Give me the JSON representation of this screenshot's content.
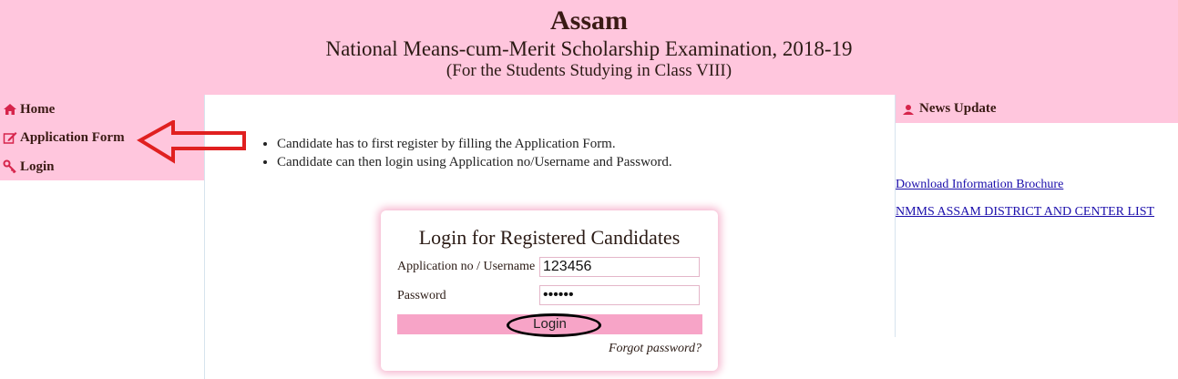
{
  "header": {
    "title": "Assam",
    "subtitle": "National Means-cum-Merit Scholarship Examination, 2018-19",
    "subtitle2": "(For the Students Studying in Class VIII)"
  },
  "sidebar": {
    "items": [
      {
        "label": "Home",
        "icon": "home-icon"
      },
      {
        "label": "Application Form",
        "icon": "edit-icon"
      },
      {
        "label": "Login",
        "icon": "key-icon"
      }
    ]
  },
  "instructions": [
    "Candidate has to first register by filling the Application Form.",
    "Candidate can then login using Application no/Username and Password."
  ],
  "login": {
    "title": "Login for Registered Candidates",
    "username_label": "Application no / Username",
    "username_value": "123456",
    "password_label": "Password",
    "password_value": "••••••",
    "button": "Login",
    "forgot": "Forgot password?"
  },
  "news": {
    "heading": "News Update",
    "links": [
      "Download Information Brochure",
      "NMMS ASSAM DISTRICT AND CENTER LIST"
    ]
  },
  "colors": {
    "header_bg": "#ffc6dd",
    "button_bg": "#f7a4c7",
    "arrow": "#e02020",
    "link": "#1a0dab"
  }
}
